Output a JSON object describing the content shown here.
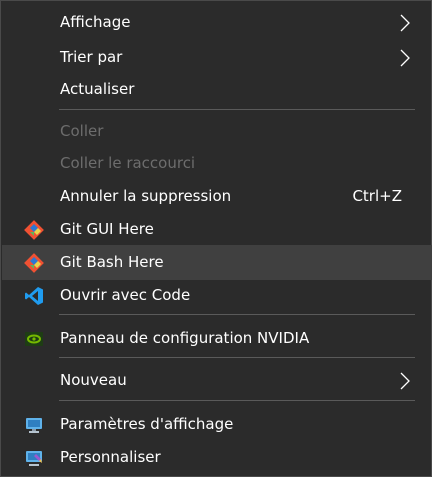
{
  "menu": {
    "items": [
      {
        "label": "Affichage",
        "submenu": true,
        "disabled": false
      },
      {
        "label": "Trier par",
        "submenu": true,
        "disabled": false
      },
      {
        "label": "Actualiser",
        "submenu": false,
        "disabled": false
      },
      {
        "label": "Coller",
        "submenu": false,
        "disabled": true
      },
      {
        "label": "Coller le raccourci",
        "submenu": false,
        "disabled": true
      },
      {
        "label": "Annuler la suppression",
        "shortcut": "Ctrl+Z",
        "disabled": false
      },
      {
        "label": "Git GUI Here",
        "icon": "git-gui-icon",
        "disabled": false
      },
      {
        "label": "Git Bash Here",
        "icon": "git-bash-icon",
        "disabled": false,
        "highlighted": true
      },
      {
        "label": "Ouvrir avec Code",
        "icon": "vscode-icon",
        "disabled": false
      },
      {
        "label": "Panneau de configuration NVIDIA",
        "icon": "nvidia-icon",
        "disabled": false
      },
      {
        "label": "Nouveau",
        "submenu": true,
        "disabled": false
      },
      {
        "label": "Paramètres d'affichage",
        "icon": "display-settings-icon",
        "disabled": false
      },
      {
        "label": "Personnaliser",
        "icon": "personalize-icon",
        "disabled": false
      }
    ]
  },
  "colors": {
    "background": "#2b2b2b",
    "text": "#ffffff",
    "disabled_text": "#6d6d6d",
    "separator": "#5a5a5a",
    "highlight": "#404040"
  }
}
